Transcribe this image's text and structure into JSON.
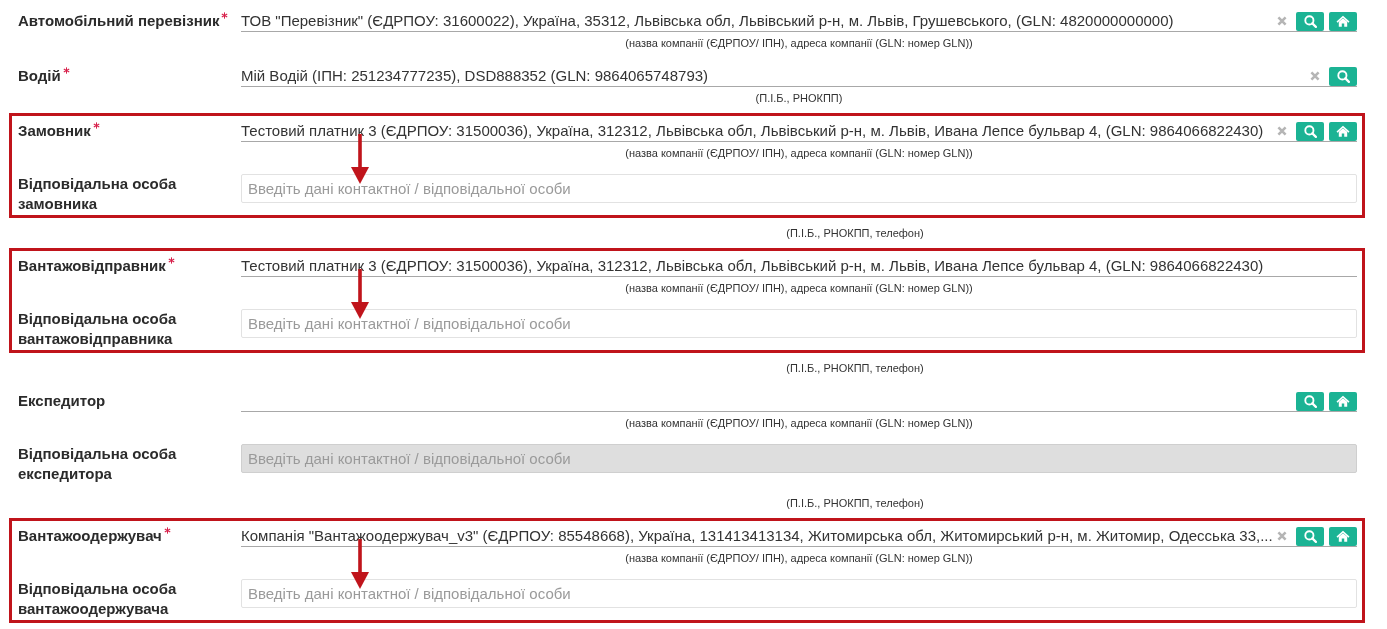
{
  "sections": [
    {
      "highlighted": false,
      "field": {
        "label": "Автомобільний перевізник",
        "required": true,
        "value": "ТОВ \"Перевізник\" (ЄДРПОУ: 31600022), Україна, 35312, Львівська обл, Львівський р-н, м. Львів, Грушевського, (GLN: 4820000000000)",
        "clearable": true,
        "buttons": [
          {
            "kind": "search"
          },
          {
            "kind": "home"
          }
        ],
        "hint": "(назва компанії (ЄДРПОУ/ ІПН), адреса компанії (GLN: номер GLN))"
      }
    },
    {
      "highlighted": false,
      "field": {
        "label": "Водій",
        "required": true,
        "value": "Мій Водій (ІПН: 251234777235), DSD888352 (GLN: 9864065748793)",
        "clearable": true,
        "buttons": [
          {
            "kind": "search"
          }
        ],
        "hint": "(П.І.Б., РНОКПП)"
      }
    },
    {
      "highlighted": true,
      "field": {
        "label": "Замовник",
        "required": true,
        "value": "Тестовий платник 3 (ЄДРПОУ: 31500036), Україна, 312312, Львівська обл, Львівський р-н, м. Львів, Ивана Лепсе бульвар 4, (GLN: 9864066822430)",
        "clearable": true,
        "buttons": [
          {
            "kind": "search"
          },
          {
            "kind": "home"
          }
        ],
        "hint": "(назва компанії (ЄДРПОУ/ ІПН), адреса компанії (GLN: номер GLN))"
      },
      "contact": {
        "label": "Відповідальна особа замовника",
        "placeholder": "Введіть дані контактної / відповідальної особи",
        "disabled": false,
        "hint": "(П.І.Б., РНОКПП, телефон)"
      }
    },
    {
      "highlighted": true,
      "field": {
        "label": "Вантажовідправник",
        "required": true,
        "value": "Тестовий платник 3 (ЄДРПОУ: 31500036), Україна, 312312, Львівська обл, Львівський р-н, м. Львів, Ивана Лепсе бульвар 4, (GLN: 9864066822430)",
        "clearable": false,
        "hint": "(назва компанії (ЄДРПОУ/ ІПН), адреса компанії (GLN: номер GLN))"
      },
      "contact": {
        "label": "Відповідальна особа вантажовідправника",
        "placeholder": "Введіть дані контактної / відповідальної особи",
        "disabled": false,
        "hint": "(П.І.Б., РНОКПП, телефон)"
      }
    },
    {
      "highlighted": false,
      "field": {
        "label": "Експедитор",
        "required": false,
        "clearable": false,
        "buttons": [
          {
            "kind": "search"
          },
          {
            "kind": "home"
          }
        ],
        "hint": "(назва компанії (ЄДРПОУ/ ІПН), адреса компанії (GLN: номер GLN))"
      },
      "contact": {
        "label": "Відповідальна особа експедитора",
        "placeholder": "Введіть дані контактної / відповідальної особи",
        "disabled": true,
        "hint": "(П.І.Б., РНОКПП, телефон)"
      }
    },
    {
      "highlighted": true,
      "field": {
        "label": "Вантажоодержувач",
        "required": true,
        "value": "Компанія \"Вантажоодержувач_v3\" (ЄДРПОУ: 85548668), Україна, 131413413134, Житомирська обл, Житомирський р-н, м. Житомир, Одесська 33,...",
        "clearable": true,
        "buttons": [
          {
            "kind": "search"
          },
          {
            "kind": "home"
          }
        ],
        "hint": "(назва компанії (ЄДРПОУ/ ІПН), адреса компанії (GLN: номер GLN))"
      },
      "contact": {
        "label": "Відповідальна особа вантажоодержувача",
        "placeholder": "Введіть дані контактної / відповідальної особи",
        "disabled": false
      }
    }
  ]
}
